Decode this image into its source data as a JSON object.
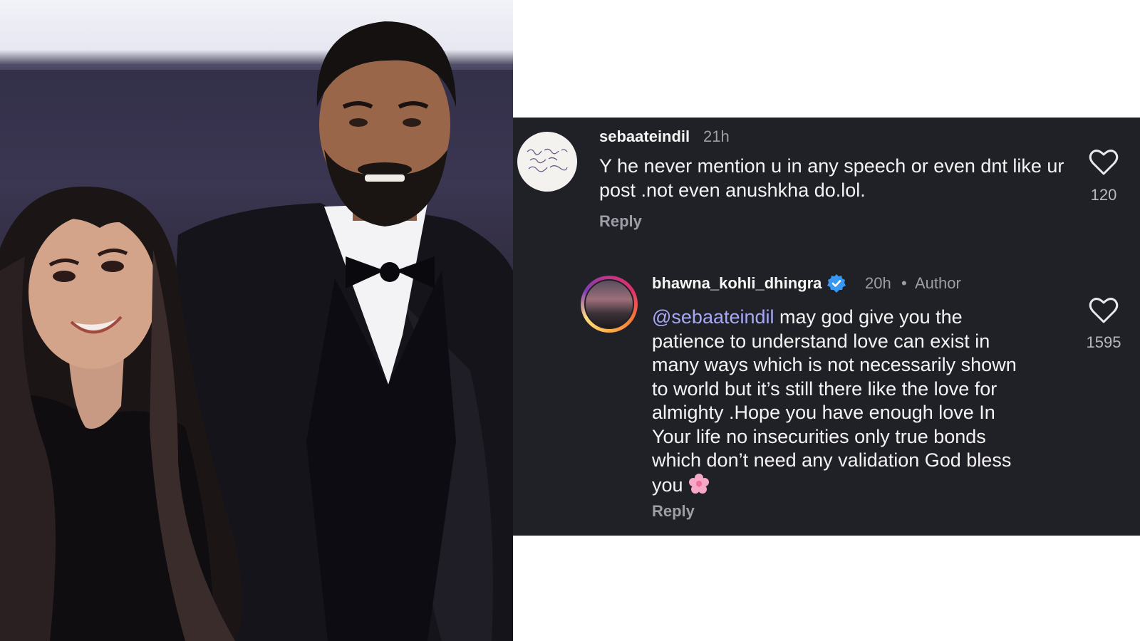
{
  "comments": [
    {
      "username": "sebaateindil",
      "time": "21h",
      "text": "Y he never mention u in any speech or even dnt like ur post .not even anushkha do.lol.",
      "reply_label": "Reply",
      "likes": "120",
      "icon": "heart-outline-icon"
    },
    {
      "username": "bhawna_kohli_dhingra",
      "time": "20h",
      "separator": "•",
      "author_tag": "Author",
      "mention": "@sebaateindil",
      "text_lines": [
        " may god give you the",
        "patience to understand love can exist in",
        "many ways which is not necessarily shown",
        "to world but it’s still there like the love for",
        "almighty .Hope  you have enough love In",
        "Your life no insecurities only true bonds",
        "which don’t need any validation God bless",
        "you"
      ],
      "emoji": "cherry-blossom-icon",
      "reply_label": "Reply",
      "likes": "1595",
      "verified_icon": "verified-badge-icon",
      "icon": "heart-outline-icon"
    }
  ],
  "colors": {
    "panel_bg": "#202027",
    "mention": "#a8a9f4",
    "verified": "#3897f0",
    "muted": "#9d9da6"
  }
}
